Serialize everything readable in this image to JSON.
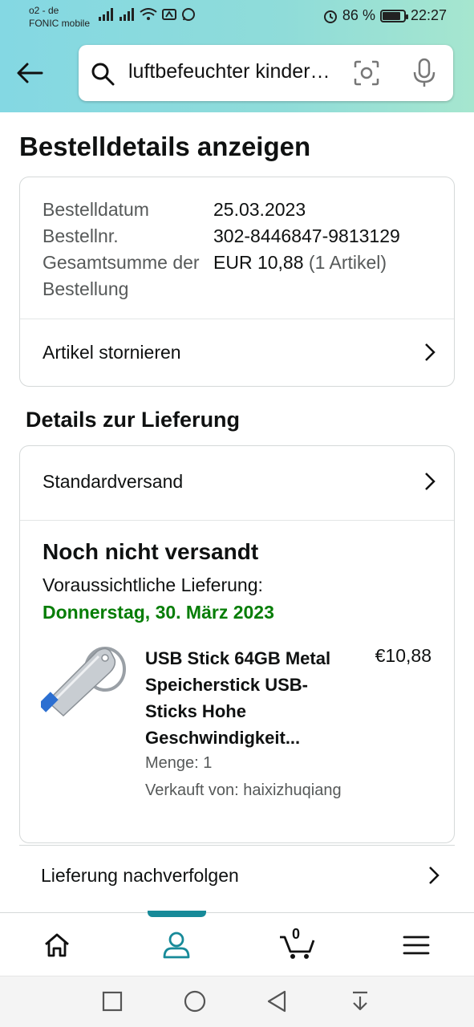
{
  "status_bar": {
    "carrier_line1": "o2 - de",
    "carrier_line2": "FONIC mobile",
    "battery_percent": "86 %",
    "battery_level": 0.86,
    "time": "22:27"
  },
  "header": {
    "search_query": "luftbefeuchter kinderzimmer",
    "back_icon": "arrow-left-icon",
    "search_icon": "search-icon",
    "camera_icon": "camera-scan-icon",
    "mic_icon": "microphone-icon"
  },
  "page": {
    "title": "Bestelldetails anzeigen"
  },
  "order_summary": {
    "date_label": "Bestelldatum",
    "date_value": "25.03.2023",
    "number_label": "Bestellnr.",
    "number_value": "302-8446847-9813129",
    "total_label": "Gesamtsumme der Bestellung",
    "total_value": "EUR 10,88",
    "total_items": "(1 Artikel)",
    "cancel_label": "Artikel stornieren"
  },
  "delivery": {
    "section_title": "Details zur Lieferung",
    "shipping_method": "Standardversand",
    "status": "Noch nicht versandt",
    "eta_label": "Voraussichtliche Lieferung:",
    "eta_date": "Donnerstag, 30. März 2023",
    "track_label": "Lieferung nachverfolgen"
  },
  "product": {
    "title": "USB Stick 64GB Metal Speicherstick USB-Sticks Hohe Geschwindigkeit...",
    "price": "€10,88",
    "quantity": "Menge: 1",
    "seller": "Verkauft von: haixizhuqiang"
  },
  "bottom_nav": {
    "cart_count": "0",
    "items": [
      "home-icon",
      "account-icon",
      "cart-icon",
      "menu-icon"
    ],
    "active": "account-icon"
  },
  "colors": {
    "accent": "#178a99",
    "green": "#067d06",
    "header_gradient_start": "#84d8e3",
    "header_gradient_end": "#a6e6cf"
  }
}
